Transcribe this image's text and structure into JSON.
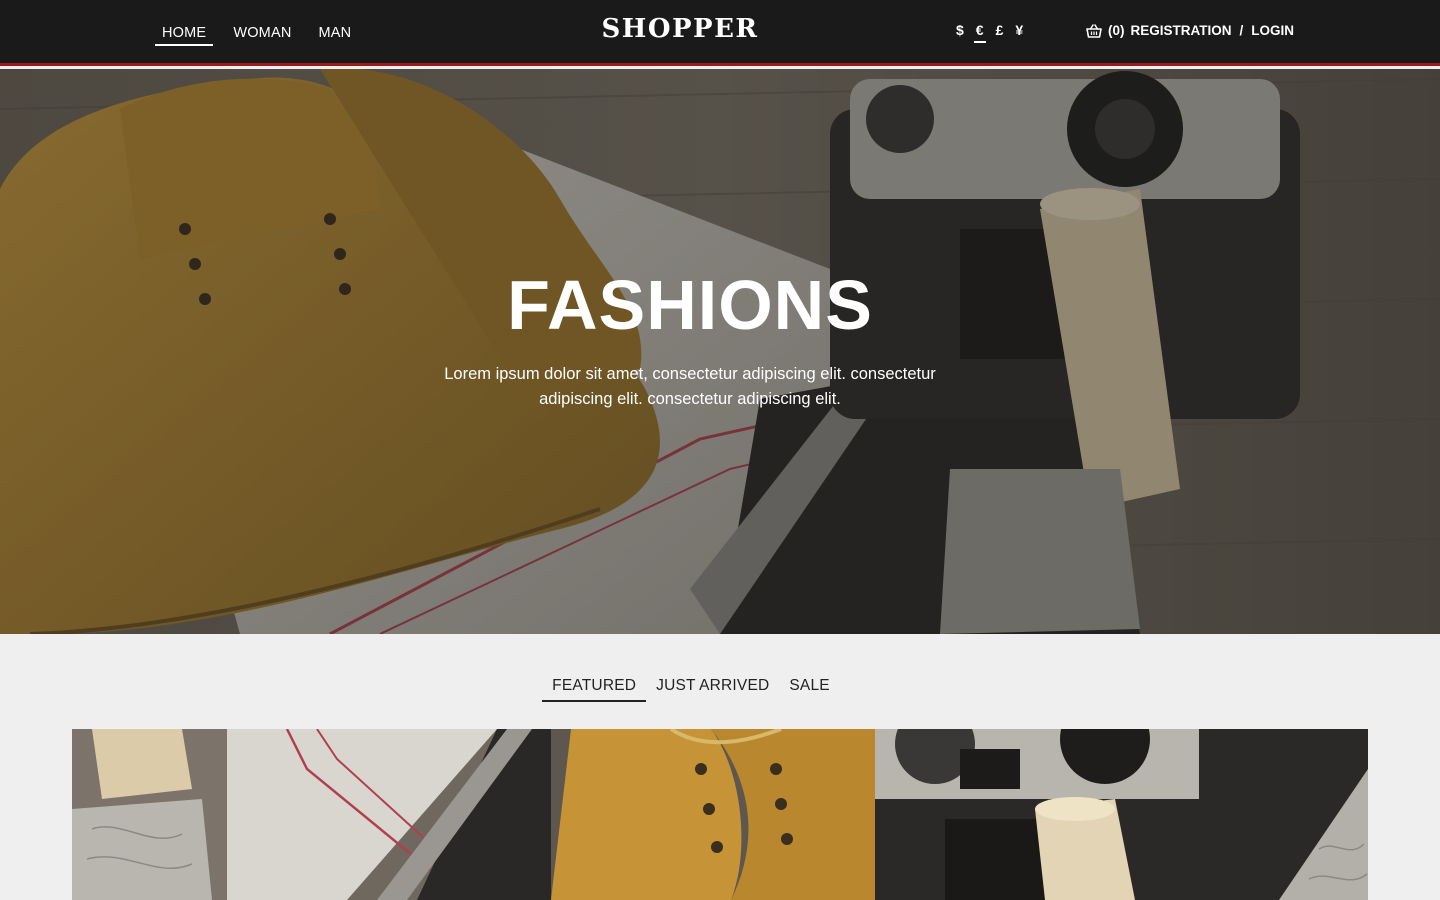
{
  "header": {
    "nav": [
      "HOME",
      "WOMAN",
      "MAN"
    ],
    "logo": "SHOPPER",
    "currencies": [
      "$",
      "€",
      "£",
      "¥"
    ],
    "active_currency": "€",
    "cart_count": "(0)",
    "registration": "REGISTRATION",
    "separator": "/",
    "login": "LOGIN",
    "accent_color": "#9b1b1b"
  },
  "hero": {
    "title": "FASHIONS",
    "text": "Lorem ipsum dolor sit amet, consectetur adipiscing elit. consectetur adipiscing elit. consectetur adipiscing elit."
  },
  "tabs": [
    "FEATURED",
    "JUST ARRIVED",
    "SALE"
  ],
  "active_tab": "FEATURED",
  "icons": {
    "cart": "basket-icon"
  }
}
